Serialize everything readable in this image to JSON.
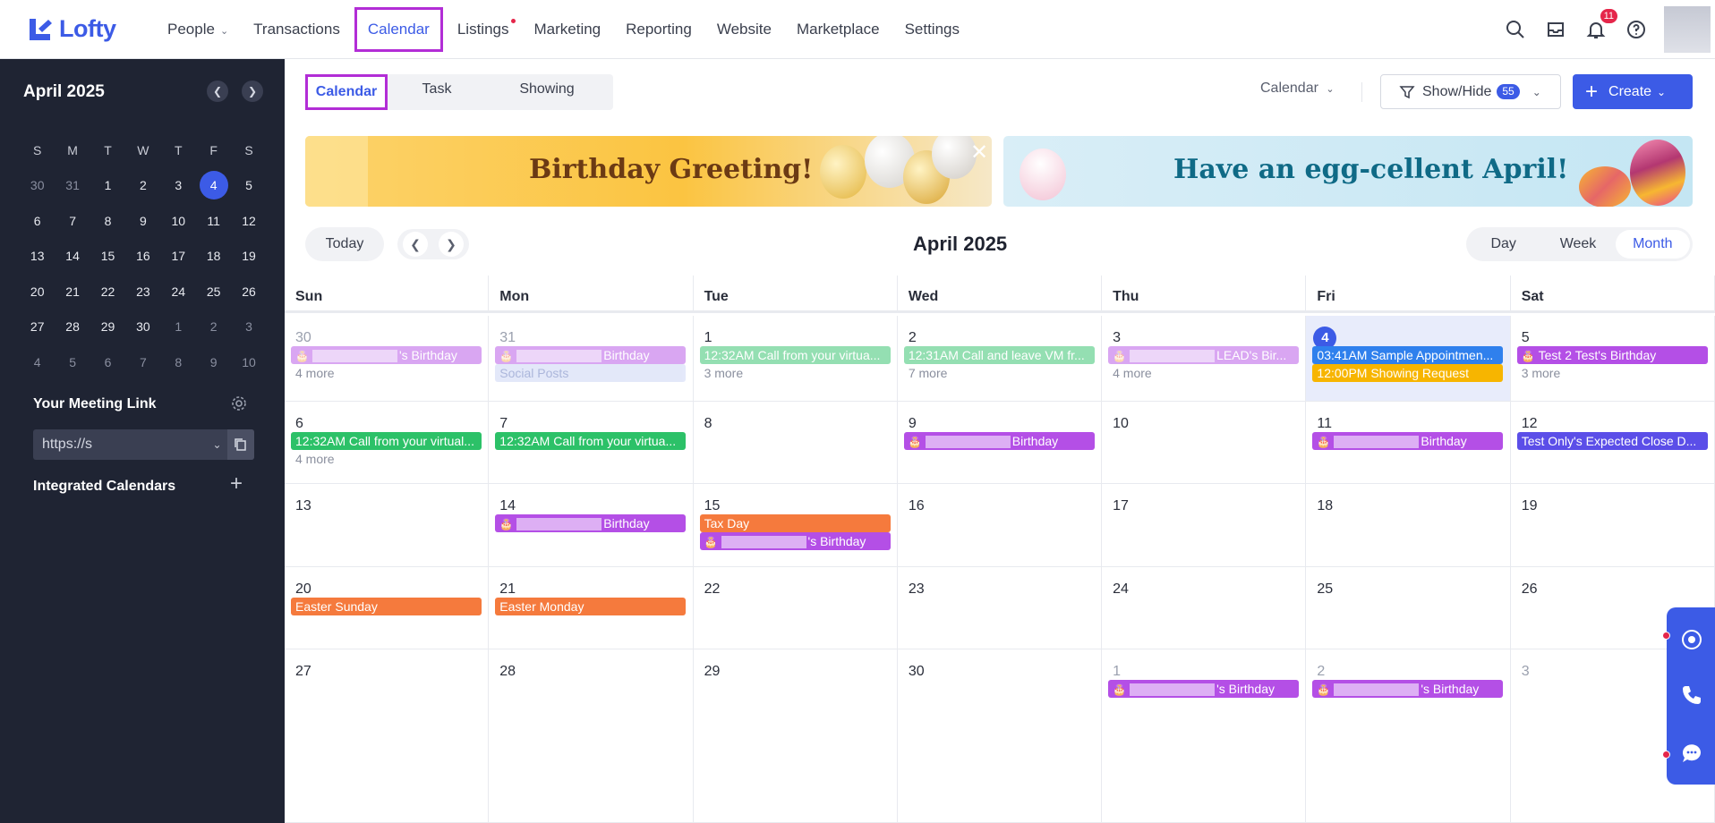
{
  "brand": {
    "name": "Lofty",
    "color": "#3c5be6"
  },
  "nav": [
    {
      "label": "People",
      "dropdown": true
    },
    {
      "label": "Transactions"
    },
    {
      "label": "Calendar",
      "active": true
    },
    {
      "label": "Listings",
      "dot": true
    },
    {
      "label": "Marketing"
    },
    {
      "label": "Reporting"
    },
    {
      "label": "Website"
    },
    {
      "label": "Marketplace"
    },
    {
      "label": "Settings"
    }
  ],
  "notifications": {
    "count": "11"
  },
  "sidebar": {
    "month_title": "April 2025",
    "weekdays": [
      "S",
      "M",
      "T",
      "W",
      "T",
      "F",
      "S"
    ],
    "weeks": [
      [
        "30",
        "31",
        "1",
        "2",
        "3",
        "4",
        "5"
      ],
      [
        "6",
        "7",
        "8",
        "9",
        "10",
        "11",
        "12"
      ],
      [
        "13",
        "14",
        "15",
        "16",
        "17",
        "18",
        "19"
      ],
      [
        "20",
        "21",
        "22",
        "23",
        "24",
        "25",
        "26"
      ],
      [
        "27",
        "28",
        "29",
        "30",
        "1",
        "2",
        "3"
      ],
      [
        "4",
        "5",
        "6",
        "7",
        "8",
        "9",
        "10"
      ]
    ],
    "meeting_link_label": "Your Meeting Link",
    "meeting_url": "https://s",
    "integrated_calendars_label": "Integrated Calendars"
  },
  "toolbar": {
    "tabs": [
      "Calendar",
      "Task",
      "Showing"
    ],
    "calendar_select": "Calendar",
    "show_hide_label": "Show/Hide",
    "show_hide_count": "55",
    "create_label": "Create"
  },
  "banners": {
    "birthday": "Birthday Greeting!",
    "easter": "Have an egg-cellent April!"
  },
  "calendar": {
    "today_label": "Today",
    "title": "April 2025",
    "views": [
      "Day",
      "Week",
      "Month"
    ],
    "active_view": "Month",
    "days_of_week": [
      "Sun",
      "Mon",
      "Tue",
      "Wed",
      "Thu",
      "Fri",
      "Sat"
    ],
    "weeks": [
      [
        {
          "num": "30",
          "out": true,
          "events": [
            {
              "text": "'s Birthday",
              "type": "birthday",
              "faded": true,
              "blur": true
            }
          ],
          "more": "4 more"
        },
        {
          "num": "31",
          "out": true,
          "events": [
            {
              "text": "Birthday",
              "type": "birthday",
              "faded": true,
              "blur": true
            },
            {
              "text": "Social Posts",
              "type": "social",
              "faded": true
            }
          ]
        },
        {
          "num": "1",
          "events": [
            {
              "text": "12:32AM Call from your virtua...",
              "type": "call",
              "faded": true
            }
          ],
          "more": "3 more"
        },
        {
          "num": "2",
          "events": [
            {
              "text": "12:31AM Call and leave VM fr...",
              "type": "call",
              "faded": true
            }
          ],
          "more": "7 more"
        },
        {
          "num": "3",
          "events": [
            {
              "text": "LEAD's Bir...",
              "type": "birthday",
              "faded": true,
              "blur": true
            }
          ],
          "more": "4 more"
        },
        {
          "num": "4",
          "today": true,
          "events": [
            {
              "text": "03:41AM Sample Appointmen...",
              "type": "appointment"
            },
            {
              "text": "12:00PM Showing Request",
              "type": "showing"
            }
          ]
        },
        {
          "num": "5",
          "events": [
            {
              "text": "Test 2 Test's Birthday",
              "type": "birthday"
            }
          ],
          "more": "3 more"
        }
      ],
      [
        {
          "num": "6",
          "events": [
            {
              "text": "12:32AM Call from your virtual...",
              "type": "call"
            }
          ],
          "more": "4 more"
        },
        {
          "num": "7",
          "events": [
            {
              "text": "12:32AM Call from your virtua...",
              "type": "call"
            }
          ]
        },
        {
          "num": "8",
          "events": []
        },
        {
          "num": "9",
          "events": [
            {
              "text": "Birthday",
              "type": "birthday",
              "blur": true
            }
          ]
        },
        {
          "num": "10",
          "events": []
        },
        {
          "num": "11",
          "events": [
            {
              "text": "Birthday",
              "type": "birthday",
              "blur": true
            }
          ]
        },
        {
          "num": "12",
          "events": [
            {
              "text": "Test Only's Expected Close D...",
              "type": "closing"
            }
          ]
        }
      ],
      [
        {
          "num": "13",
          "events": []
        },
        {
          "num": "14",
          "events": [
            {
              "text": "Birthday",
              "type": "birthday",
              "blur": true
            }
          ]
        },
        {
          "num": "15",
          "events": [
            {
              "text": "Tax Day",
              "type": "holiday"
            },
            {
              "text": "'s Birthday",
              "type": "birthday",
              "blur": true
            }
          ]
        },
        {
          "num": "16",
          "events": []
        },
        {
          "num": "17",
          "events": []
        },
        {
          "num": "18",
          "events": []
        },
        {
          "num": "19",
          "events": []
        }
      ],
      [
        {
          "num": "20",
          "events": [
            {
              "text": "Easter Sunday",
              "type": "holiday"
            }
          ]
        },
        {
          "num": "21",
          "events": [
            {
              "text": "Easter Monday",
              "type": "holiday"
            }
          ]
        },
        {
          "num": "22",
          "events": []
        },
        {
          "num": "23",
          "events": []
        },
        {
          "num": "24",
          "events": []
        },
        {
          "num": "25",
          "events": []
        },
        {
          "num": "26",
          "events": []
        }
      ],
      [
        {
          "num": "27",
          "events": []
        },
        {
          "num": "28",
          "events": []
        },
        {
          "num": "29",
          "events": []
        },
        {
          "num": "30",
          "events": []
        },
        {
          "num": "1",
          "out": true,
          "events": [
            {
              "text": "'s Birthday",
              "type": "birthday",
              "blur": true
            }
          ]
        },
        {
          "num": "2",
          "out": true,
          "events": [
            {
              "text": "'s Birthday",
              "type": "birthday",
              "blur": true
            }
          ]
        },
        {
          "num": "3",
          "out": true,
          "events": []
        }
      ]
    ]
  },
  "event_colors": {
    "birthday": "#b44fe6",
    "call": "#2cc168",
    "appointment": "#2f80ed",
    "showing": "#f7b500",
    "holiday": "#f57a3d",
    "closing": "#5b4ee8",
    "social": "#c9d3f5"
  }
}
